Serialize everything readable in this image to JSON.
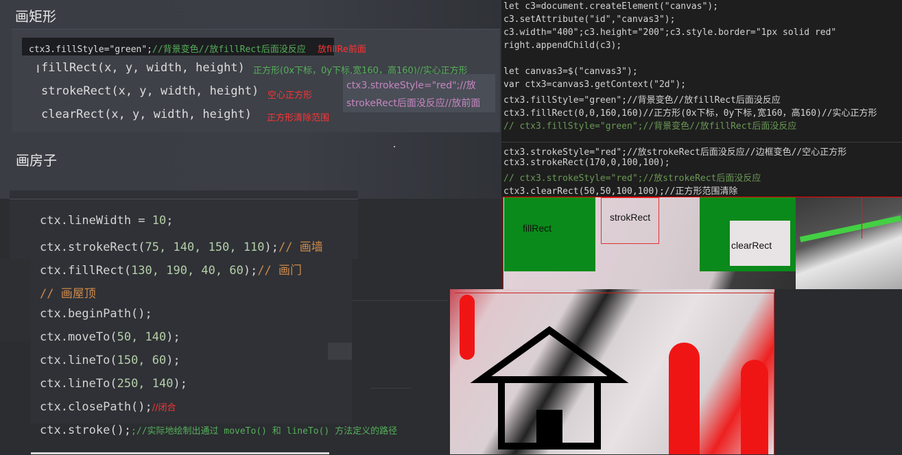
{
  "left": {
    "section_rect": "画矩形",
    "fill_tip_code": "ctx3.fillStyle=\"green\";",
    "fill_tip_comment": "//背景变色//放fillRect后面没反应",
    "fill_tip_note": "放fillRe前面",
    "lines": [
      {
        "code": "fillRect(x, y, width, height)",
        "note": "正方形(0x下标，0y下标,宽160，高160)//实心正方形"
      },
      {
        "code": "strokeRect(x, y, width, height)",
        "note": "空心正方形"
      },
      {
        "code": "clearRect(x, y, width, height)",
        "note": "正方形清除范围"
      }
    ],
    "stroke_tip_1": "ctx3.strokeStyle=\"red\";//放",
    "stroke_tip_2": "strokeRect后面没反应//放前面",
    "section_house": "画房子"
  },
  "house_code": [
    {
      "a": "ctx.lineWidth = ",
      "n": "10",
      "b": ";",
      "c": ""
    },
    {
      "a": "ctx.strokeRect(",
      "n": "75, 140, 150, 110",
      "b": ");",
      "c": "// 画墙"
    },
    {
      "a": "ctx.fillRect(",
      "n": "130, 190, 40, 60",
      "b": ");",
      "c": "// 画门"
    },
    {
      "a": "",
      "n": "",
      "b": "",
      "c": "// 画屋顶"
    },
    {
      "a": "ctx.beginPath();",
      "n": "",
      "b": "",
      "c": ""
    },
    {
      "a": "ctx.moveTo(",
      "n": "50, 140",
      "b": ");",
      "c": ""
    },
    {
      "a": "ctx.lineTo(",
      "n": "150, 60",
      "b": ");",
      "c": ""
    },
    {
      "a": "ctx.lineTo(",
      "n": "250, 140",
      "b": ");",
      "c": ""
    },
    {
      "a": "ctx.closePath();",
      "n": "",
      "b": "",
      "c": "//闭合"
    },
    {
      "a": "ctx.stroke();",
      "n": "",
      "b": "",
      "c": ";//实际地绘制出通过 moveTo() 和 lineTo() 方法定义的路径"
    }
  ],
  "right_code": [
    "let c3=document.createElement(\"canvas\");",
    "c3.setAttribute(\"id\",\"canvas3\");",
    "c3.width=\"400\";c3.height=\"200\";c3.style.border=\"1px solid red\"",
    "right.appendChild(c3);",
    "",
    "let canvas3=$(\"canvas3\");",
    "var ctx3=canvas3.getContext(\"2d\");",
    "ctx3.fillStyle=\"green\";//背景变色//放fillRect后面没反应",
    "ctx3.fillRect(0,0,160,160)//正方形(0x下标，0y下标,宽160，高160)//实心正方形",
    "// ctx3.fillStyle=\"green\";//背景变色//放fillRect后面没反应",
    "",
    "ctx3.strokeStyle=\"red\";//放strokeRect后面没反应//边框变色//空心正方形",
    "ctx3.strokeRect(170,0,100,100);",
    "// ctx3.strokeStyle=\"red\";//放strokeRect后面没反应",
    "ctx3.clearRect(50,50,100,100);//正方形范围清除"
  ],
  "canvas_labels": {
    "fill": "fillRect",
    "stroke": "strokRect",
    "clear": "clearRect"
  },
  "colors": {
    "canvas_green": "#0a8a1a",
    "canvas_border": "#ff0000"
  }
}
